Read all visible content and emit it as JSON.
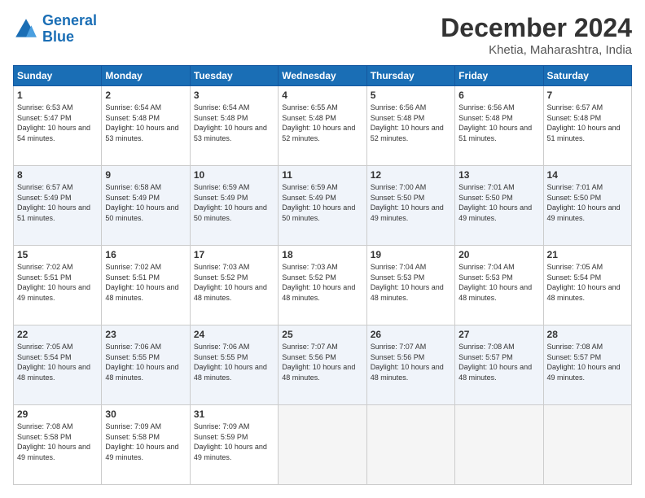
{
  "logo": {
    "text_general": "General",
    "text_blue": "Blue"
  },
  "header": {
    "month": "December 2024",
    "location": "Khetia, Maharashtra, India"
  },
  "days_of_week": [
    "Sunday",
    "Monday",
    "Tuesday",
    "Wednesday",
    "Thursday",
    "Friday",
    "Saturday"
  ],
  "weeks": [
    [
      {
        "day": "1",
        "sunrise": "6:53 AM",
        "sunset": "5:47 PM",
        "daylight": "10 hours and 54 minutes."
      },
      {
        "day": "2",
        "sunrise": "6:54 AM",
        "sunset": "5:48 PM",
        "daylight": "10 hours and 53 minutes."
      },
      {
        "day": "3",
        "sunrise": "6:54 AM",
        "sunset": "5:48 PM",
        "daylight": "10 hours and 53 minutes."
      },
      {
        "day": "4",
        "sunrise": "6:55 AM",
        "sunset": "5:48 PM",
        "daylight": "10 hours and 52 minutes."
      },
      {
        "day": "5",
        "sunrise": "6:56 AM",
        "sunset": "5:48 PM",
        "daylight": "10 hours and 52 minutes."
      },
      {
        "day": "6",
        "sunrise": "6:56 AM",
        "sunset": "5:48 PM",
        "daylight": "10 hours and 51 minutes."
      },
      {
        "day": "7",
        "sunrise": "6:57 AM",
        "sunset": "5:48 PM",
        "daylight": "10 hours and 51 minutes."
      }
    ],
    [
      {
        "day": "8",
        "sunrise": "6:57 AM",
        "sunset": "5:49 PM",
        "daylight": "10 hours and 51 minutes."
      },
      {
        "day": "9",
        "sunrise": "6:58 AM",
        "sunset": "5:49 PM",
        "daylight": "10 hours and 50 minutes."
      },
      {
        "day": "10",
        "sunrise": "6:59 AM",
        "sunset": "5:49 PM",
        "daylight": "10 hours and 50 minutes."
      },
      {
        "day": "11",
        "sunrise": "6:59 AM",
        "sunset": "5:49 PM",
        "daylight": "10 hours and 50 minutes."
      },
      {
        "day": "12",
        "sunrise": "7:00 AM",
        "sunset": "5:50 PM",
        "daylight": "10 hours and 49 minutes."
      },
      {
        "day": "13",
        "sunrise": "7:01 AM",
        "sunset": "5:50 PM",
        "daylight": "10 hours and 49 minutes."
      },
      {
        "day": "14",
        "sunrise": "7:01 AM",
        "sunset": "5:50 PM",
        "daylight": "10 hours and 49 minutes."
      }
    ],
    [
      {
        "day": "15",
        "sunrise": "7:02 AM",
        "sunset": "5:51 PM",
        "daylight": "10 hours and 49 minutes."
      },
      {
        "day": "16",
        "sunrise": "7:02 AM",
        "sunset": "5:51 PM",
        "daylight": "10 hours and 48 minutes."
      },
      {
        "day": "17",
        "sunrise": "7:03 AM",
        "sunset": "5:52 PM",
        "daylight": "10 hours and 48 minutes."
      },
      {
        "day": "18",
        "sunrise": "7:03 AM",
        "sunset": "5:52 PM",
        "daylight": "10 hours and 48 minutes."
      },
      {
        "day": "19",
        "sunrise": "7:04 AM",
        "sunset": "5:53 PM",
        "daylight": "10 hours and 48 minutes."
      },
      {
        "day": "20",
        "sunrise": "7:04 AM",
        "sunset": "5:53 PM",
        "daylight": "10 hours and 48 minutes."
      },
      {
        "day": "21",
        "sunrise": "7:05 AM",
        "sunset": "5:54 PM",
        "daylight": "10 hours and 48 minutes."
      }
    ],
    [
      {
        "day": "22",
        "sunrise": "7:05 AM",
        "sunset": "5:54 PM",
        "daylight": "10 hours and 48 minutes."
      },
      {
        "day": "23",
        "sunrise": "7:06 AM",
        "sunset": "5:55 PM",
        "daylight": "10 hours and 48 minutes."
      },
      {
        "day": "24",
        "sunrise": "7:06 AM",
        "sunset": "5:55 PM",
        "daylight": "10 hours and 48 minutes."
      },
      {
        "day": "25",
        "sunrise": "7:07 AM",
        "sunset": "5:56 PM",
        "daylight": "10 hours and 48 minutes."
      },
      {
        "day": "26",
        "sunrise": "7:07 AM",
        "sunset": "5:56 PM",
        "daylight": "10 hours and 48 minutes."
      },
      {
        "day": "27",
        "sunrise": "7:08 AM",
        "sunset": "5:57 PM",
        "daylight": "10 hours and 48 minutes."
      },
      {
        "day": "28",
        "sunrise": "7:08 AM",
        "sunset": "5:57 PM",
        "daylight": "10 hours and 49 minutes."
      }
    ],
    [
      {
        "day": "29",
        "sunrise": "7:08 AM",
        "sunset": "5:58 PM",
        "daylight": "10 hours and 49 minutes."
      },
      {
        "day": "30",
        "sunrise": "7:09 AM",
        "sunset": "5:58 PM",
        "daylight": "10 hours and 49 minutes."
      },
      {
        "day": "31",
        "sunrise": "7:09 AM",
        "sunset": "5:59 PM",
        "daylight": "10 hours and 49 minutes."
      },
      null,
      null,
      null,
      null
    ]
  ]
}
